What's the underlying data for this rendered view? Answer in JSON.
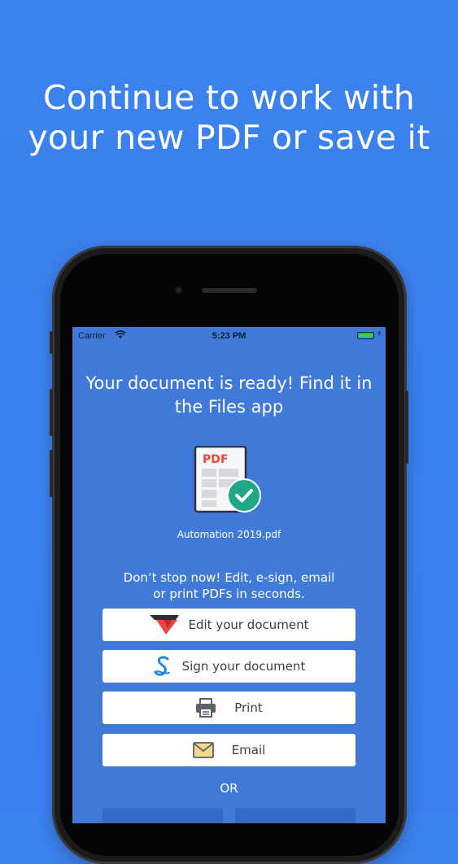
{
  "headline": {
    "line1": "Continue to work with",
    "line2": "your new PDF or save it"
  },
  "status_bar": {
    "carrier": "Carrier",
    "time": "5:23 PM"
  },
  "ready_message": {
    "line1": "Your document is ready! Find it in",
    "line2": "the Files app"
  },
  "document": {
    "icon_label": "PDF",
    "filename": "Automation 2019.pdf"
  },
  "promo": {
    "line1": "Don’t stop now! Edit, e-sign, email",
    "line2": "or print PDFs in seconds."
  },
  "actions": {
    "edit": "Edit your document",
    "sign": "Sign your document",
    "print": "Print",
    "email": "Email"
  },
  "separator": "OR",
  "colors": {
    "background": "#3b82ee",
    "screen": "#3f7ad8",
    "check_badge": "#1fa786",
    "pdf_red": "#e8483f"
  }
}
